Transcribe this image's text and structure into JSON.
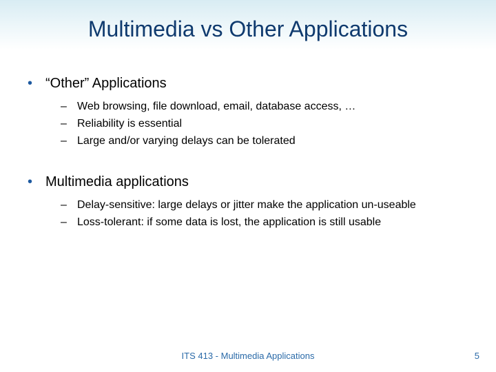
{
  "title": "Multimedia vs Other Applications",
  "sections": [
    {
      "heading": "“Other” Applications",
      "items": [
        "Web browsing, file download, email, database access, …",
        "Reliability is essential",
        "Large and/or varying delays can be tolerated"
      ]
    },
    {
      "heading": "Multimedia applications",
      "items": [
        "Delay-sensitive: large delays or jitter make the application un-useable",
        "Loss-tolerant: if some data is lost, the application is still usable"
      ]
    }
  ],
  "footer": "ITS 413 - Multimedia Applications",
  "page_number": "5",
  "bullet_glyph": "•",
  "dash_glyph": "–"
}
